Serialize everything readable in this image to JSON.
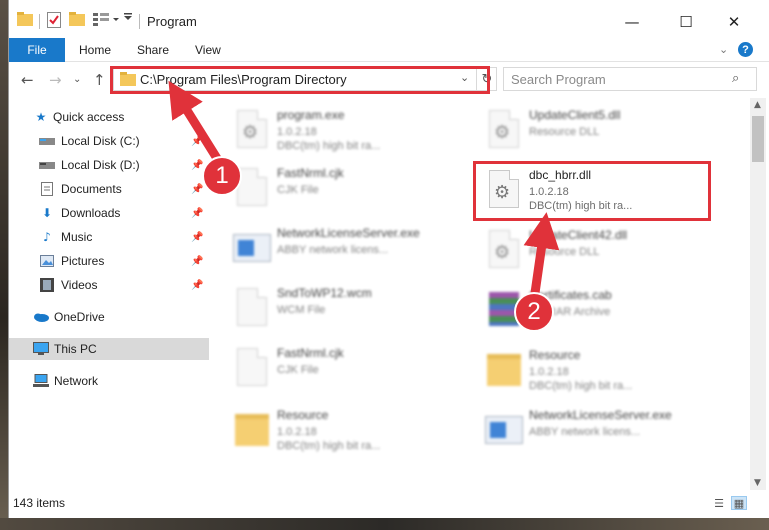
{
  "window": {
    "title": "Program",
    "controls": {
      "minimize": "—",
      "maximize": "☐",
      "close": "✕"
    }
  },
  "ribbon": {
    "file": "File",
    "tabs": [
      "Home",
      "Share",
      "View"
    ]
  },
  "navbar": {
    "address": "C:\\Program Files\\Program Directory",
    "search_placeholder": "Search Program"
  },
  "sidebar": {
    "items": [
      {
        "label": "Quick access",
        "icon": "star-icon",
        "pinned": false
      },
      {
        "label": "Local Disk (C:)",
        "icon": "drive-icon",
        "pinned": true
      },
      {
        "label": "Local Disk (D:)",
        "icon": "drive-icon",
        "pinned": true
      },
      {
        "label": "Documents",
        "icon": "documents-icon",
        "pinned": true
      },
      {
        "label": "Downloads",
        "icon": "download-icon",
        "pinned": true
      },
      {
        "label": "Music",
        "icon": "music-icon",
        "pinned": true
      },
      {
        "label": "Pictures",
        "icon": "pictures-icon",
        "pinned": true
      },
      {
        "label": "Videos",
        "icon": "videos-icon",
        "pinned": true
      },
      {
        "label": "OneDrive",
        "icon": "cloud-icon",
        "pinned": false
      },
      {
        "label": "This PC",
        "icon": "computer-icon",
        "pinned": false,
        "selected": true
      },
      {
        "label": "Network",
        "icon": "network-icon",
        "pinned": false
      }
    ]
  },
  "files": [
    {
      "name": "program.exe",
      "line2": "1.0.2.18",
      "line3": "DBC(tm) high bit ra...",
      "icon": "exe-icon"
    },
    {
      "name": "UpdateClient5.dll",
      "line2": "Resource DLL",
      "line3": "",
      "icon": "dll-icon"
    },
    {
      "name": "FastNrml.cjk",
      "line2": "CJK File",
      "line3": "",
      "icon": "file-icon"
    },
    {
      "name": "dbc_hbrr.dll",
      "line2": "1.0.2.18",
      "line3": "DBC(tm) high bit ra...",
      "icon": "dll-icon"
    },
    {
      "name": "NetworkLicenseServer.exe",
      "line2": "ABBY network licens...",
      "line3": "",
      "icon": "app-icon"
    },
    {
      "name": "UpdateClient42.dll",
      "line2": "Resource DLL",
      "line3": "",
      "icon": "dll-icon"
    },
    {
      "name": "SndToWP12.wcm",
      "line2": "WCM File",
      "line3": "",
      "icon": "file-icon"
    },
    {
      "name": "Certificates.cab",
      "line2": "WinRAR Archive",
      "line3": "",
      "icon": "archive-icon"
    },
    {
      "name": "FastNrml.cjk",
      "line2": "CJK File",
      "line3": "",
      "icon": "file-icon"
    },
    {
      "name": "Resource",
      "line2": "1.0.2.18",
      "line3": "DBC(tm) high bit ra...",
      "icon": "folder-icon"
    },
    {
      "name": "Resource",
      "line2": "1.0.2.18",
      "line3": "DBC(tm) high bit ra...",
      "icon": "folder-icon"
    },
    {
      "name": "NetworkLicenseServer.exe",
      "line2": "ABBY network licens...",
      "line3": "",
      "icon": "app-icon"
    }
  ],
  "status": {
    "item_count": "143 items"
  },
  "callouts": {
    "step1": "1",
    "step2": "2"
  },
  "colors": {
    "accent": "#1979ca",
    "callout": "#e0323a"
  }
}
